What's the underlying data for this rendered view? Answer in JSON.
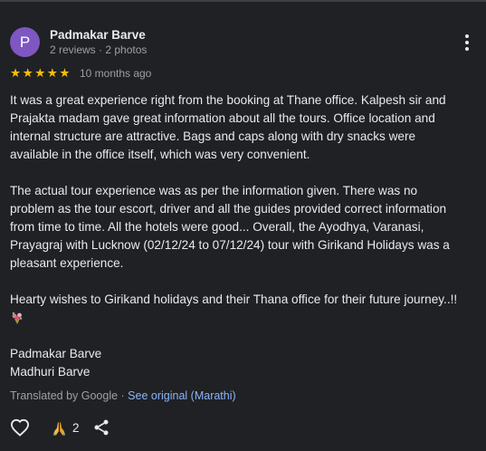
{
  "review": {
    "avatar_letter": "P",
    "avatar_color": "#7e57c2",
    "reviewer_name": "Padmakar Barve",
    "reviewer_meta": "2 reviews · 2 photos",
    "rating": 5,
    "stars": [
      "★",
      "★",
      "★",
      "★",
      "★"
    ],
    "time_ago": "10 months ago",
    "paragraphs": [
      [
        "It was a great experience right from the booking at Thane office. Kalpesh sir and",
        "Prajakta madam gave great information about all the tours. Office location and",
        "internal structure are attractive. Bags and caps along with dry snacks were",
        "available in the office itself, which was very convenient."
      ],
      [
        "The actual tour experience was as per the information given. There was no",
        "problem as the tour escort, driver and all the guides provided correct information",
        "from time to time. All the hotels were good... Overall, the Ayodhya, Varanasi,",
        "Prayagraj with Lucknow (02/12/24 to 07/12/24) tour with Girikand Holidays was a",
        "pleasant experience."
      ],
      [
        "Hearty wishes to Girikand holidays and their Thana office for their future journey..!!"
      ]
    ],
    "signature": [
      "Padmakar Barve",
      "Madhuri Barve"
    ],
    "translated_by": "Translated by Google",
    "translated_sep": " · ",
    "see_original": "See original (Marathi)",
    "reaction_count": "2",
    "icons": {
      "more": "more-vert-icon",
      "like": "heart-outline-icon",
      "reaction": "folded-hands-icon",
      "share": "share-icon",
      "bouquet": "bouquet-emoji"
    },
    "colors": {
      "background": "#202124",
      "star": "#fbbc04",
      "link": "#8ab4f8",
      "secondary_text": "#9aa0a6"
    }
  }
}
